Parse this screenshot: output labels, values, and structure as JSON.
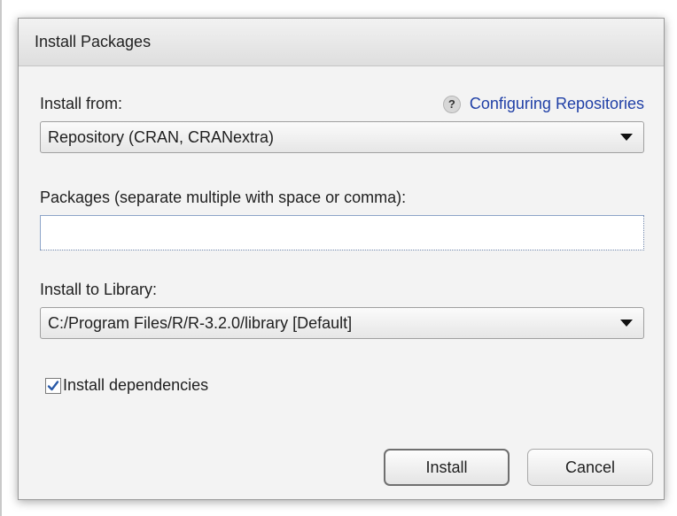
{
  "dialog": {
    "title": "Install Packages",
    "install_from_label": "Install from:",
    "help_link": "Configuring Repositories",
    "help_icon_glyph": "?",
    "install_from_value": "Repository (CRAN, CRANextra)",
    "packages_label": "Packages (separate multiple with space or comma):",
    "packages_value": "",
    "library_label": "Install to Library:",
    "library_value": "C:/Program Files/R/R-3.2.0/library [Default]",
    "dependencies_label": "Install dependencies",
    "dependencies_checked": true,
    "install_button": "Install",
    "cancel_button": "Cancel"
  },
  "colors": {
    "link": "#1f3fa6",
    "checkmark": "#2a5aa8"
  },
  "icons": [
    "help-icon",
    "dropdown-caret-icon",
    "checkmark-icon"
  ]
}
